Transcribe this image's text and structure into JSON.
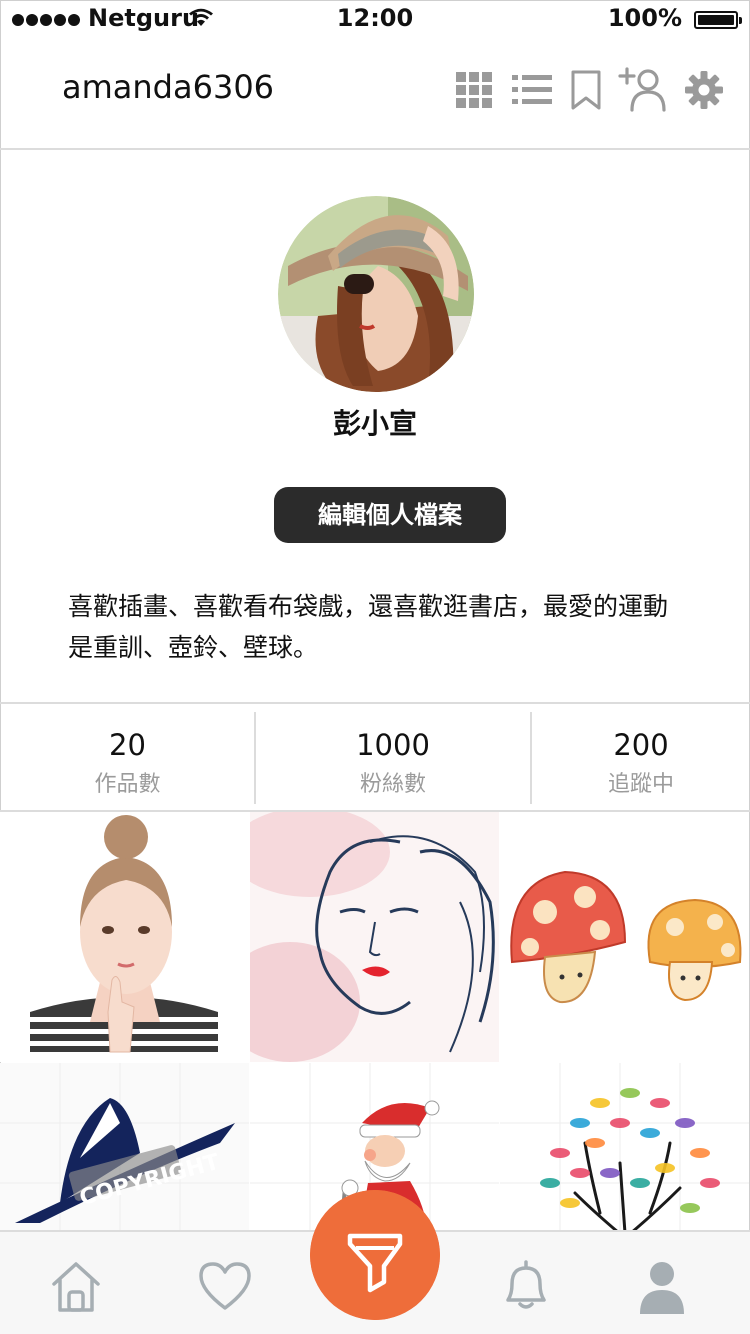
{
  "status_bar": {
    "carrier": "Netguru",
    "time": "12:00",
    "battery": "100%"
  },
  "header": {
    "username": "amanda6306",
    "icons": [
      "grid-icon",
      "list-icon",
      "bookmark-icon",
      "add-friend-icon",
      "gear-icon"
    ]
  },
  "profile": {
    "name": "彭小宣",
    "edit_button": "編輯個人檔案",
    "bio": "喜歡插畫、喜歡看布袋戲，還喜歡逛書店，最愛的運動是重訓、壺鈴、壁球。"
  },
  "stats": [
    {
      "value": "20",
      "label": "作品數"
    },
    {
      "value": "1000",
      "label": "粉絲數"
    },
    {
      "value": "200",
      "label": "追蹤中"
    }
  ],
  "gallery": {
    "watermark": "COPYRIGHT"
  },
  "tab_bar": {
    "items": [
      "home-icon",
      "heart-icon",
      "brush-icon",
      "bell-icon",
      "user-icon"
    ],
    "accent": "#ee6d3a"
  }
}
